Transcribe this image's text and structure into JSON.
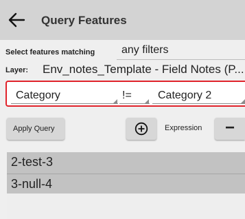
{
  "header": {
    "back_icon": "arrow-left-icon",
    "title": "Query Features"
  },
  "query": {
    "match_label": "Select features matching",
    "match_value": "any filters",
    "layer_label": "Layer:",
    "layer_value": "Env_notes_Template - Field Notes (P..."
  },
  "filter": {
    "field": "Category",
    "operator": "!=",
    "value": "Category 2",
    "highlight_color": "#e0232b"
  },
  "actions": {
    "apply_label": "Apply Query",
    "add_icon": "plus-circle-icon",
    "expression_label": "Expression",
    "remove_label": "−"
  },
  "results": {
    "items": [
      {
        "label": "2-test-3"
      },
      {
        "label": "3-null-4"
      }
    ]
  }
}
